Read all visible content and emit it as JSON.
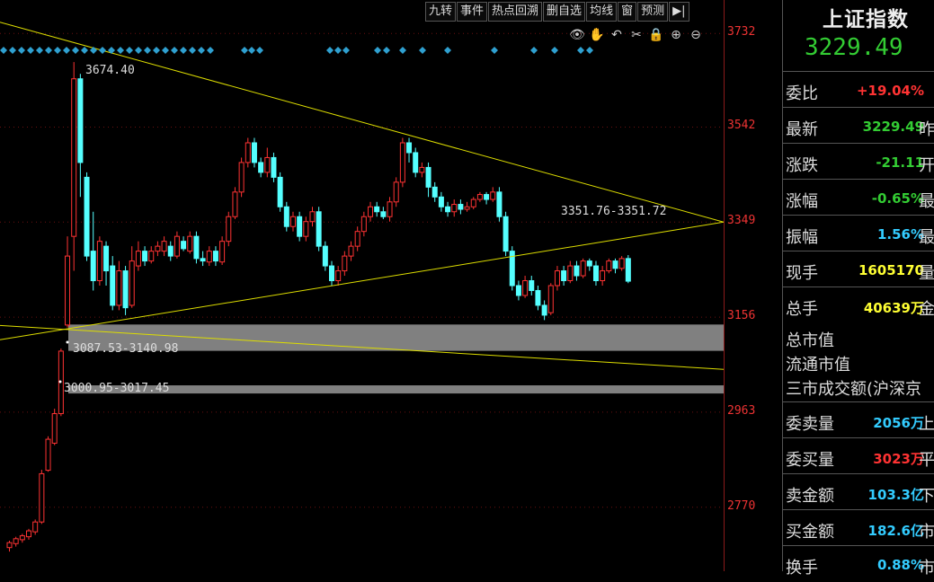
{
  "toolbar": {
    "items": [
      "九转",
      "事件",
      "热点回溯",
      "删自选",
      "均线",
      "窗",
      "预测",
      "▶|"
    ]
  },
  "icons": [
    "eye-icon",
    "hand-icon",
    "undo-icon",
    "scissors-icon",
    "lock-icon",
    "zoom-in-icon",
    "zoom-out-icon"
  ],
  "axis": {
    "labels": [
      "3732",
      "3542",
      "3349",
      "3156",
      "2963",
      "2770"
    ]
  },
  "annotations": {
    "high": "3674.40",
    "gap1": "3087.53-3140.98",
    "gap2": "3000.95-3017.45",
    "flat": "3351.76-3351.72"
  },
  "panel": {
    "title": "上证指数",
    "price": "3229.49",
    "rows": [
      {
        "label": "委比",
        "value": "+19.04%",
        "color": "#ff3333",
        "cut": "",
        "gap": ""
      },
      {
        "label": "最新",
        "value": "3229.49",
        "color": "#33cc33",
        "cut": "昨",
        "gap": ""
      },
      {
        "label": "涨跌",
        "value": "-21.11",
        "color": "#33cc33",
        "cut": "开",
        "gap": ""
      },
      {
        "label": "涨幅",
        "value": "-0.65%",
        "color": "#33cc33",
        "cut": "最",
        "gap": ""
      },
      {
        "label": "振幅",
        "value": "1.56%",
        "color": "#33ccff",
        "cut": "最",
        "gap": ""
      },
      {
        "label": "现手",
        "value": "1605170",
        "color": "#ffff33",
        "cut": "量",
        "gap": ""
      },
      {
        "label": "总手",
        "value": "40639万",
        "color": "#ffff33",
        "cut": "金",
        "gap": ""
      }
    ],
    "info": [
      "总市值",
      "流通市值",
      "三市成交额(沪深京"
    ],
    "rows2": [
      {
        "label": "委卖量",
        "value": "2056万",
        "color": "#33ccff",
        "cut": "上"
      },
      {
        "label": "委买量",
        "value": "3023万",
        "color": "#ff3333",
        "cut": "平"
      },
      {
        "label": "卖金额",
        "value": "103.3亿",
        "color": "#33ccff",
        "cut": "下"
      },
      {
        "label": "买金额",
        "value": "182.6亿",
        "color": "#33ccff",
        "cut": "市"
      },
      {
        "label": "换手",
        "value": "0.88%",
        "color": "#33ccff",
        "cut": "市"
      }
    ]
  },
  "colors": {
    "up": "#ff3333",
    "down": "#55ffff",
    "trendline": "#dddd00",
    "gapbox": "#808080",
    "signal": "#2fa0d0"
  },
  "chart_data": {
    "type": "candlestick",
    "ylim": [
      2640,
      3800
    ],
    "gaps": [
      [
        3087.53,
        3140.98
      ],
      [
        3000.95,
        3017.45
      ]
    ],
    "candles": [
      [
        2688,
        2698,
        2680,
        2702
      ],
      [
        2696,
        2706,
        2690,
        2710
      ],
      [
        2704,
        2712,
        2698,
        2716
      ],
      [
        2710,
        2722,
        2704,
        2726
      ],
      [
        2720,
        2740,
        2714,
        2745
      ],
      [
        2740,
        2838,
        2736,
        2846
      ],
      [
        2845,
        2908,
        2842,
        2914
      ],
      [
        2900,
        2960,
        2896,
        2970
      ],
      [
        2960,
        3087,
        2955,
        3092
      ],
      [
        3140,
        3280,
        3135,
        3320
      ],
      [
        3320,
        3640,
        3250,
        3674
      ],
      [
        3640,
        3470,
        3400,
        3650
      ],
      [
        3440,
        3280,
        3270,
        3450
      ],
      [
        3290,
        3230,
        3210,
        3370
      ],
      [
        3230,
        3310,
        3220,
        3320
      ],
      [
        3300,
        3250,
        3220,
        3310
      ],
      [
        3260,
        3180,
        3170,
        3280
      ],
      [
        3180,
        3250,
        3170,
        3270
      ],
      [
        3250,
        3175,
        3160,
        3260
      ],
      [
        3180,
        3270,
        3175,
        3300
      ],
      [
        3260,
        3290,
        3250,
        3310
      ],
      [
        3290,
        3270,
        3260,
        3300
      ],
      [
        3270,
        3290,
        3265,
        3300
      ],
      [
        3290,
        3300,
        3280,
        3310
      ],
      [
        3290,
        3310,
        3280,
        3320
      ],
      [
        3300,
        3280,
        3270,
        3310
      ],
      [
        3280,
        3320,
        3275,
        3330
      ],
      [
        3310,
        3295,
        3290,
        3320
      ],
      [
        3290,
        3320,
        3285,
        3330
      ],
      [
        3320,
        3275,
        3265,
        3330
      ],
      [
        3275,
        3270,
        3260,
        3290
      ],
      [
        3268,
        3290,
        3260,
        3300
      ],
      [
        3290,
        3270,
        3260,
        3300
      ],
      [
        3268,
        3310,
        3262,
        3320
      ],
      [
        3310,
        3360,
        3300,
        3370
      ],
      [
        3360,
        3410,
        3355,
        3420
      ],
      [
        3410,
        3470,
        3400,
        3480
      ],
      [
        3470,
        3510,
        3460,
        3520
      ],
      [
        3510,
        3470,
        3460,
        3520
      ],
      [
        3470,
        3450,
        3440,
        3480
      ],
      [
        3450,
        3480,
        3440,
        3500
      ],
      [
        3480,
        3440,
        3430,
        3490
      ],
      [
        3440,
        3380,
        3370,
        3450
      ],
      [
        3380,
        3340,
        3330,
        3390
      ],
      [
        3340,
        3360,
        3330,
        3370
      ],
      [
        3360,
        3320,
        3310,
        3370
      ],
      [
        3320,
        3350,
        3310,
        3360
      ],
      [
        3350,
        3370,
        3340,
        3380
      ],
      [
        3370,
        3300,
        3290,
        3380
      ],
      [
        3300,
        3260,
        3250,
        3310
      ],
      [
        3260,
        3230,
        3220,
        3270
      ],
      [
        3230,
        3250,
        3220,
        3260
      ],
      [
        3250,
        3280,
        3240,
        3290
      ],
      [
        3280,
        3300,
        3270,
        3310
      ],
      [
        3300,
        3330,
        3290,
        3340
      ],
      [
        3330,
        3360,
        3320,
        3370
      ],
      [
        3360,
        3380,
        3350,
        3390
      ],
      [
        3380,
        3370,
        3360,
        3390
      ],
      [
        3370,
        3360,
        3355,
        3380
      ],
      [
        3360,
        3390,
        3350,
        3400
      ],
      [
        3390,
        3430,
        3380,
        3440
      ],
      [
        3430,
        3510,
        3420,
        3520
      ],
      [
        3510,
        3490,
        3470,
        3520
      ],
      [
        3490,
        3450,
        3440,
        3500
      ],
      [
        3450,
        3460,
        3440,
        3470
      ],
      [
        3460,
        3420,
        3400,
        3470
      ],
      [
        3420,
        3400,
        3390,
        3430
      ],
      [
        3400,
        3380,
        3370,
        3410
      ],
      [
        3380,
        3370,
        3360,
        3390
      ],
      [
        3370,
        3385,
        3360,
        3395
      ],
      [
        3385,
        3375,
        3365,
        3395
      ],
      [
        3375,
        3380,
        3370,
        3390
      ],
      [
        3380,
        3395,
        3375,
        3400
      ],
      [
        3395,
        3405,
        3390,
        3410
      ],
      [
        3405,
        3395,
        3385,
        3410
      ],
      [
        3395,
        3410,
        3390,
        3420
      ],
      [
        3410,
        3360,
        3350,
        3420
      ],
      [
        3360,
        3290,
        3280,
        3370
      ],
      [
        3290,
        3220,
        3210,
        3300
      ],
      [
        3220,
        3200,
        3190,
        3230
      ],
      [
        3200,
        3230,
        3195,
        3240
      ],
      [
        3230,
        3210,
        3200,
        3240
      ],
      [
        3210,
        3180,
        3170,
        3220
      ],
      [
        3180,
        3160,
        3150,
        3190
      ],
      [
        3165,
        3220,
        3160,
        3225
      ],
      [
        3220,
        3250,
        3210,
        3260
      ],
      [
        3250,
        3230,
        3220,
        3260
      ],
      [
        3230,
        3260,
        3225,
        3270
      ],
      [
        3260,
        3240,
        3230,
        3270
      ],
      [
        3240,
        3270,
        3235,
        3275
      ],
      [
        3270,
        3260,
        3250,
        3275
      ],
      [
        3260,
        3230,
        3220,
        3270
      ],
      [
        3230,
        3250,
        3220,
        3260
      ],
      [
        3250,
        3270,
        3245,
        3275
      ],
      [
        3270,
        3255,
        3245,
        3275
      ],
      [
        3255,
        3275,
        3250,
        3280
      ],
      [
        3275,
        3229,
        3225,
        3282
      ]
    ]
  }
}
